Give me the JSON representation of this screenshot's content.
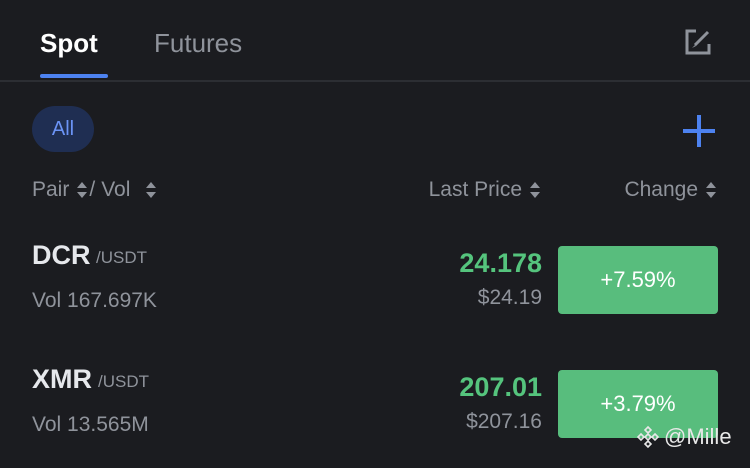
{
  "tabs": {
    "spot": "Spot",
    "futures": "Futures"
  },
  "filter": {
    "all": "All"
  },
  "columns": {
    "pair": "Pair",
    "separator": "/",
    "vol": "Vol",
    "last_price": "Last Price",
    "change": "Change"
  },
  "rows": [
    {
      "base": "DCR",
      "quote": "/USDT",
      "volume": "Vol 167.697K",
      "price": "24.178",
      "fiat_price": "$24.19",
      "change": "+7.59%"
    },
    {
      "base": "XMR",
      "quote": "/USDT",
      "volume": "Vol 13.565M",
      "price": "207.01",
      "fiat_price": "$207.16",
      "change": "+3.79%"
    }
  ],
  "watermark": "@Mille",
  "colors": {
    "accent": "#4d82f0",
    "positive": "#55c47d",
    "positive_bg": "#58bd7d",
    "background": "#1b1c20"
  },
  "icons": {
    "edit": "edit-icon",
    "add": "plus-icon",
    "sort": "sort-icon",
    "watermark": "binance-logo-icon"
  }
}
